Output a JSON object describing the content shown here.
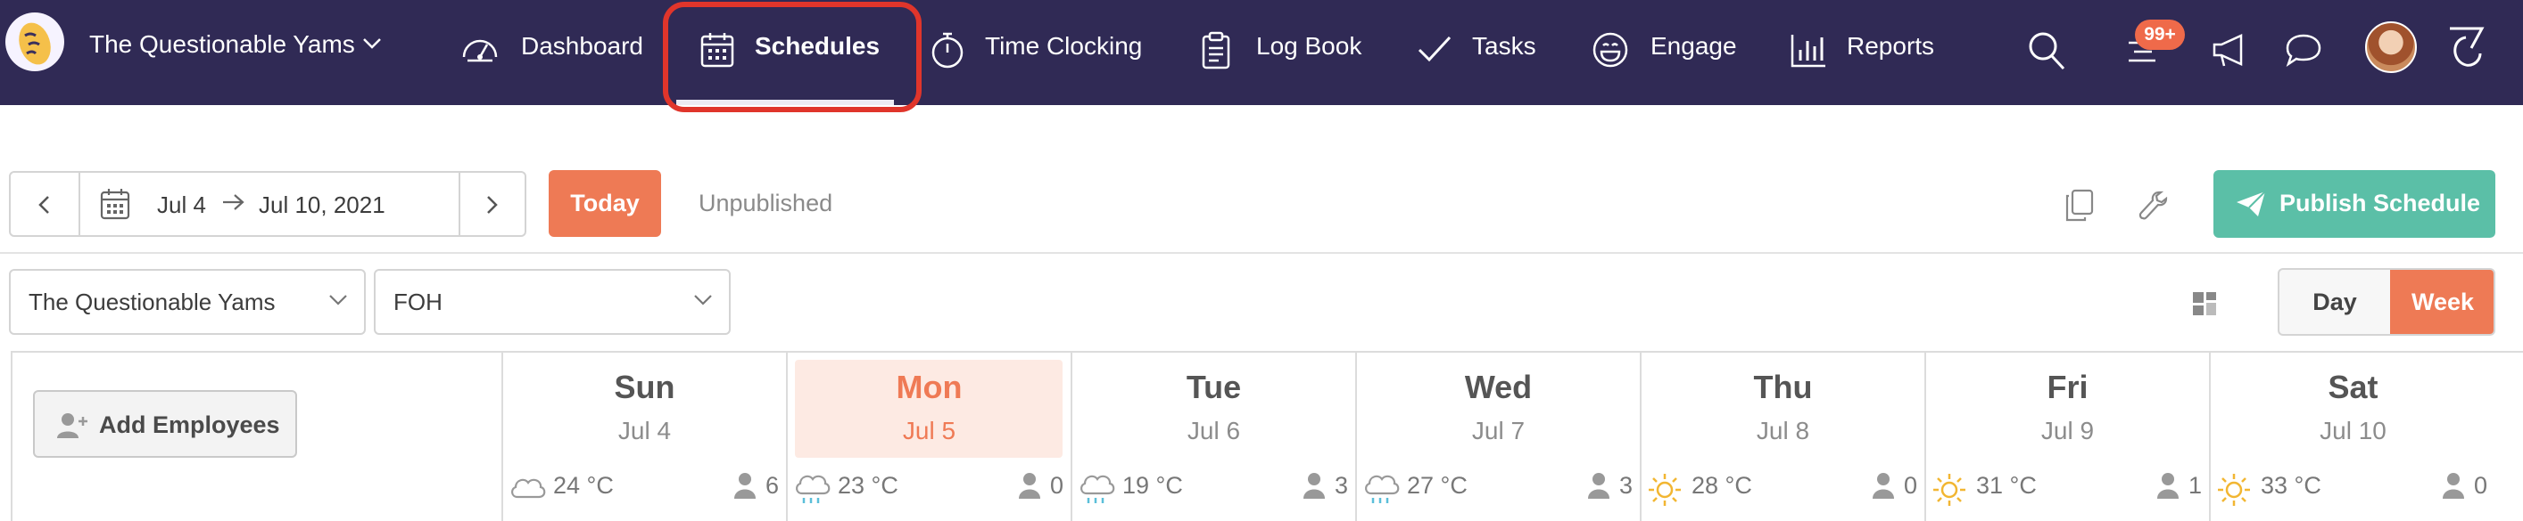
{
  "nav": {
    "brand": "The Questionable Yams",
    "items": [
      {
        "label": "Dashboard",
        "icon": "speedometer-icon"
      },
      {
        "label": "Schedules",
        "icon": "calendar-icon",
        "active": true
      },
      {
        "label": "Time Clocking",
        "icon": "stopwatch-icon"
      },
      {
        "label": "Log Book",
        "icon": "clipboard-icon"
      },
      {
        "label": "Tasks",
        "icon": "checkmark-icon"
      },
      {
        "label": "Engage",
        "icon": "smiley-icon"
      },
      {
        "label": "Reports",
        "icon": "bar-chart-icon"
      }
    ],
    "notification_badge": "99+",
    "colors": {
      "bar": "#302a55",
      "highlight": "#e0352b",
      "badge": "#ef6a4a"
    }
  },
  "toolbar": {
    "date_start": "Jul 4",
    "date_end": "Jul 10, 2021",
    "today_label": "Today",
    "status": "Unpublished",
    "publish_label": "Publish Schedule",
    "colors": {
      "today": "#ee7a55",
      "publish": "#5bbfa7"
    }
  },
  "filters": {
    "location": "The Questionable Yams",
    "department": "FOH",
    "view_day": "Day",
    "view_week": "Week",
    "active_view": "Week"
  },
  "schedule": {
    "add_employees_label": "Add Employees",
    "days": [
      {
        "name": "Sun",
        "date": "Jul 4",
        "weather": "cloud-icon",
        "temp": "24 °C",
        "staff": "6"
      },
      {
        "name": "Mon",
        "date": "Jul 5",
        "weather": "rain-icon",
        "temp": "23 °C",
        "staff": "0",
        "today": true
      },
      {
        "name": "Tue",
        "date": "Jul 6",
        "weather": "rain-icon",
        "temp": "19 °C",
        "staff": "3"
      },
      {
        "name": "Wed",
        "date": "Jul 7",
        "weather": "rain-icon",
        "temp": "27 °C",
        "staff": "3"
      },
      {
        "name": "Thu",
        "date": "Jul 8",
        "weather": "sun-icon",
        "temp": "28 °C",
        "staff": "0"
      },
      {
        "name": "Fri",
        "date": "Jul 9",
        "weather": "sun-icon",
        "temp": "31 °C",
        "staff": "1"
      },
      {
        "name": "Sat",
        "date": "Jul 10",
        "weather": "sun-icon",
        "temp": "33 °C",
        "staff": "0"
      }
    ]
  }
}
